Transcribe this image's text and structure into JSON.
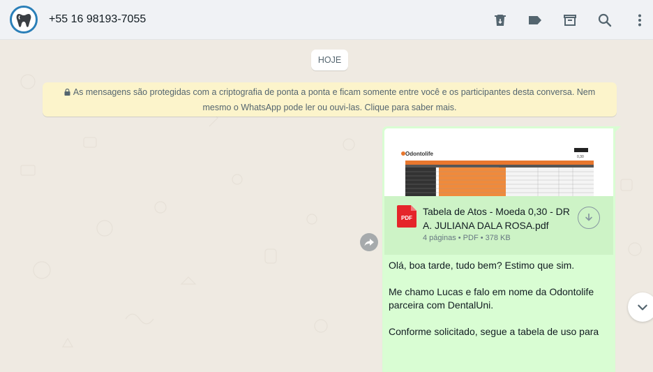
{
  "header": {
    "contact_name": "+55 16 98193-7055",
    "icons": [
      "delete-icon",
      "label-icon",
      "archive-icon",
      "search-icon",
      "menu-icon"
    ]
  },
  "chat": {
    "date_chip": "HOJE",
    "encryption_notice": "As mensagens são protegidas com a criptografia de ponta a ponta e ficam somente entre você e os participantes desta conversa. Nem mesmo o WhatsApp pode ler ou ouvi-las. Clique para saber mais.",
    "message": {
      "document": {
        "name": "Tabela de Atos - Moeda 0,30 - DR A. JULIANA DALA ROSA.pdf",
        "meta": "4 páginas • PDF • 378 KB",
        "icon_label": "PDF",
        "thumb_brand": "Odontolife",
        "thumb_price": "0,30"
      },
      "text_lines": [
        "Olá, boa tarde, tudo bem? Estimo que sim.",
        "Me chamo Lucas e falo em nome da Odontolife parceira com DentalUni.",
        "Conforme solicitado, segue a tabela de uso para"
      ]
    }
  },
  "colors": {
    "header_bg": "#f0f2f5",
    "chat_bg": "#efeae2",
    "outgoing_bubble": "#d9fdd3",
    "encryption_banner": "#fcf4cb",
    "pdf_red": "#e5252a"
  }
}
